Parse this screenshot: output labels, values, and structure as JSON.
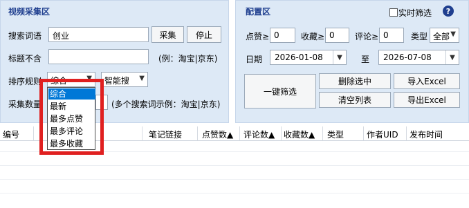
{
  "video_panel": {
    "title": "视频采集区",
    "search_label": "搜索词语",
    "search_value": "创业",
    "collect_button": "采集",
    "stop_button": "停止",
    "title_exclude_label": "标题不含",
    "title_exclude_value": "",
    "title_exclude_hint": "(例：淘宝|京东)",
    "sort_label": "排序规则",
    "sort_value": "综合",
    "smart_search_value": "智能搜",
    "collect_count_label": "采集数量",
    "multi_search_hint": "(多个搜索词示例：淘宝|京东)",
    "sort_options": [
      "综合",
      "最新",
      "最多点赞",
      "最多评论",
      "最多收藏"
    ]
  },
  "config_panel": {
    "title": "配置区",
    "realtime_filter_label": "实时筛选",
    "likes_label": "点赞≥",
    "likes_value": "0",
    "favorites_label": "收藏≥",
    "favorites_value": "0",
    "comments_label": "评论≥",
    "comments_value": "0",
    "type_label": "类型",
    "type_value": "全部",
    "date_label": "日期",
    "date_from": "2026-01-08",
    "to_label": "至",
    "date_to": "2026-07-08",
    "one_click_filter_button": "一键筛选",
    "delete_selected_button": "删除选中",
    "import_excel_button": "导入Excel",
    "clear_list_button": "清空列表",
    "export_excel_button": "导出Excel"
  },
  "table": {
    "columns": [
      "编号",
      "笔记链接",
      "点赞数▲",
      "评论数▲",
      "收藏数▲",
      "类型",
      "作者UID",
      "发布时间"
    ]
  },
  "colors": {
    "panel_bg": "#dde9f6",
    "title_color": "#1f3f8f",
    "highlight_red": "#e02020",
    "selection_blue": "#0078d7"
  }
}
